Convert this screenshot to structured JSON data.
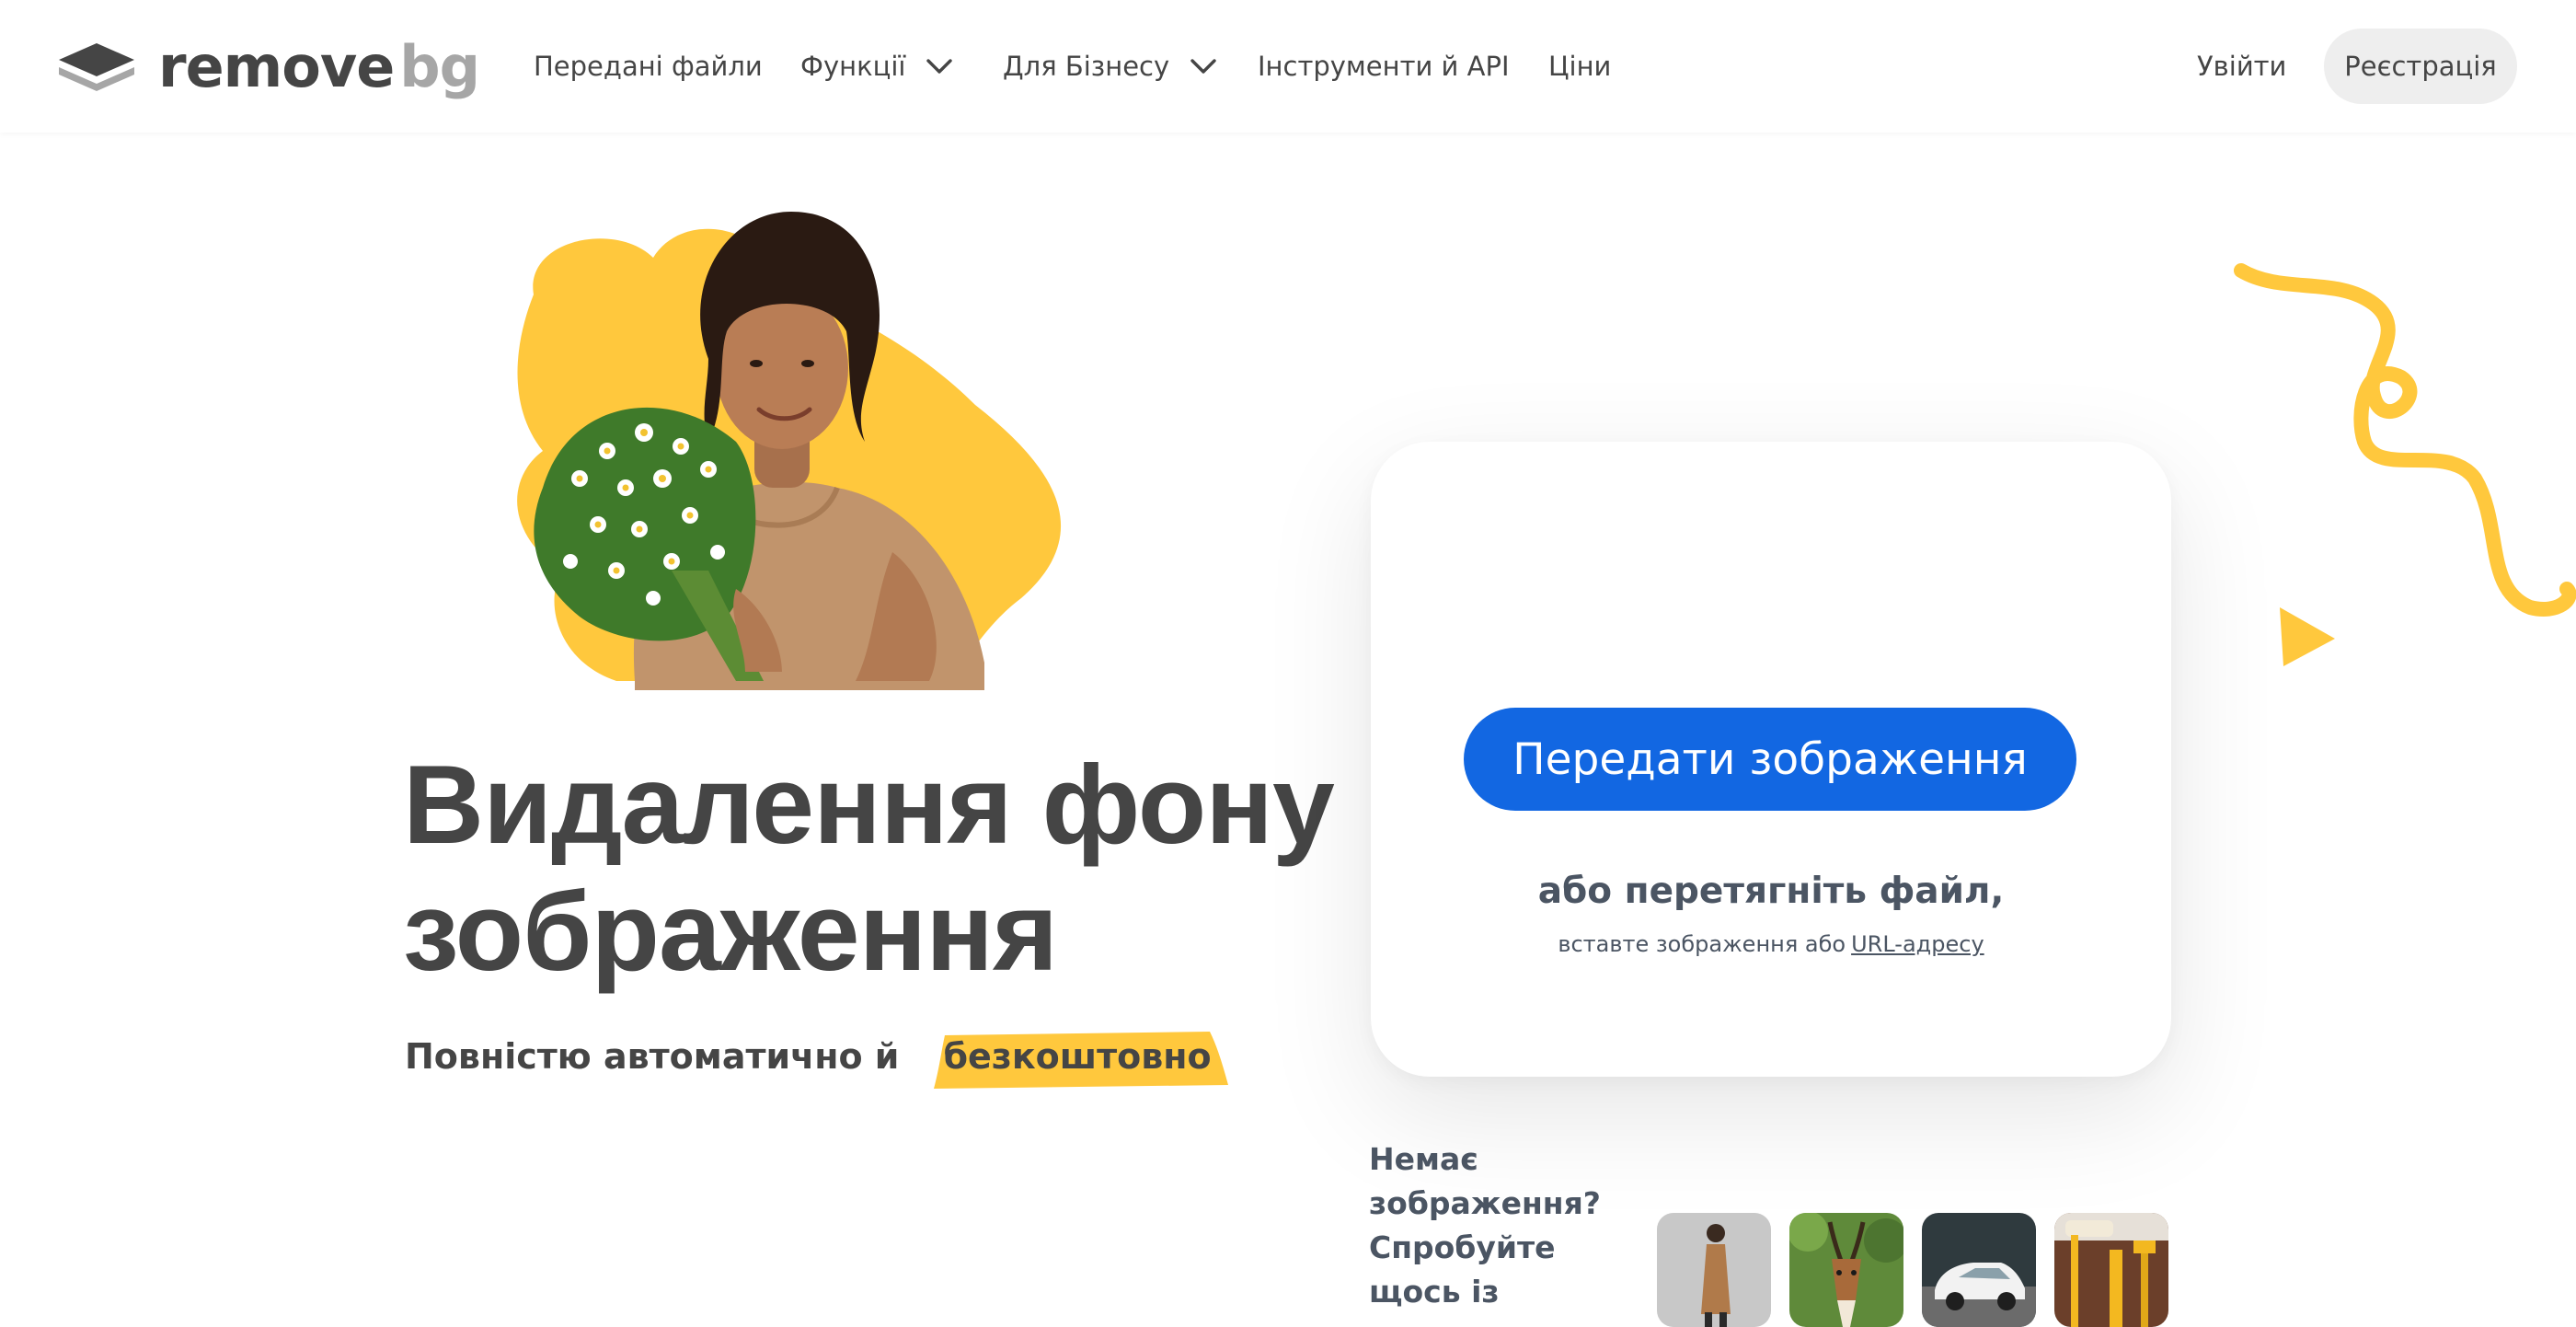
{
  "brand": {
    "word1": "remove",
    "word2": "bg",
    "color_dark": "#454545",
    "color_light": "#a6a6a6"
  },
  "nav": {
    "uploads": "Передані файли",
    "features": "Функції",
    "business": "Для Бізнесу",
    "tools_api": "Інструменти й API",
    "pricing": "Ціни"
  },
  "auth": {
    "login": "Увійти",
    "signup": "Реєстрація"
  },
  "hero": {
    "title_line1": "Видалення фону",
    "title_line2": "зображення",
    "subtitle": "Повністю автоматично й",
    "subtitle_highlight": "безкоштовно",
    "accent_color": "#ffc83d"
  },
  "upload": {
    "button": "Передати зображення",
    "drop_title": "або перетягніть файл,",
    "drop_hint": "вставте зображення або",
    "drop_hint_link": "URL-адресу",
    "button_color": "#1267e2"
  },
  "samples": {
    "prompt": "Немає зображення? Спробуйте щось із",
    "items": [
      "woman-sample",
      "antelope-sample",
      "car-sample",
      "paint-roller-sample"
    ]
  },
  "icons": [
    "logo-icon",
    "chevron-down-icon",
    "squiggle-decoration",
    "triangle-decoration"
  ]
}
